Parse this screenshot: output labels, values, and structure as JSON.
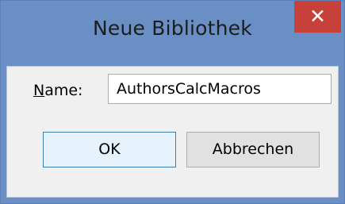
{
  "dialog": {
    "title": "Neue Bibliothek",
    "close_glyph": "✕"
  },
  "form": {
    "name_label_mnemonic": "N",
    "name_label_rest": "ame:",
    "name_value": "AuthorsCalcMacros"
  },
  "buttons": {
    "ok_label": "OK",
    "cancel_label": "Abbrechen"
  },
  "colors": {
    "titlebar": "#6a8fc4",
    "close_button": "#c7403a",
    "client": "#f0f0f0"
  }
}
